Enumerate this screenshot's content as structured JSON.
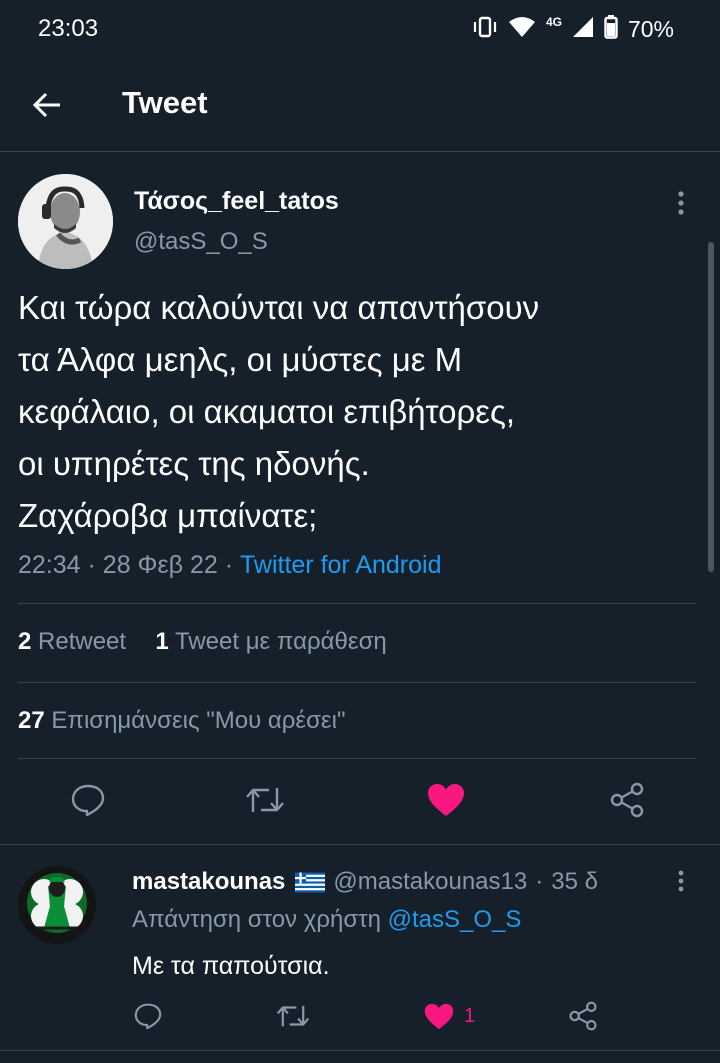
{
  "status_bar": {
    "time": "23:03",
    "network": "4G",
    "battery": "70%"
  },
  "header": {
    "title": "Tweet"
  },
  "tweet": {
    "author_name": "Τάσος_feel_tatos",
    "author_handle": "@tasS_O_S",
    "text_lines": [
      "Και τώρα καλούνται να απαντήσουν",
      "τα Άλφα μεηλς, οι μύστες με Μ",
      "κεφάλαιο, οι ακαματοι επιβήτορες,",
      "οι υπηρέτες της ηδονής.",
      "Ζαχάροβα μπαίνατε;"
    ],
    "time": "22:34",
    "date": "28 Φεβ 22",
    "client": "Twitter for Android",
    "retweets_count": "2",
    "retweets_label": "Retweet",
    "quotes_count": "1",
    "quotes_label": "Tweet με παράθεση",
    "likes_count": "27",
    "likes_label": "Επισημάνσεις \"Μου αρέσει\""
  },
  "reply": {
    "author_name": "mastakounas",
    "author_handle": "@mastakounas13",
    "age": "35 δ",
    "replying_to_label": "Απάντηση στον χρήστη",
    "replying_to_handle": "@tasS_O_S",
    "text": "Με τα παπούτσια.",
    "like_count": "1"
  },
  "colors": {
    "background": "#15202b",
    "accent": "#1d9bf0",
    "like": "#f91880",
    "muted": "#8899a6"
  }
}
